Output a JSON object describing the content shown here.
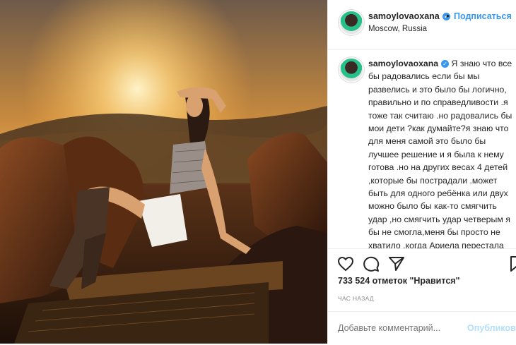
{
  "header": {
    "username": "samoylovaoxana",
    "verified": "✓",
    "separator": "•",
    "follow_label": "Подписаться",
    "location": "Moscow, Russia"
  },
  "caption": {
    "username": "samoylovaoxana",
    "verified": "✓",
    "text": "Я знаю что все бы радовались если бы мы развелись и это было бы логично, правильно и по справедливости .я тоже так считаю .но радовались бы мои дети ?как думайте?я знаю что для меня самой это было бы лучшее решение и я была к нему готова .но на других весах 4 детей ,которые бы пострадали .может быть для одного ребёнка или двух можно было бы как-то смягчить удар ,но смягчить удар четверым я бы не смогла,меня бы просто не хватило .когда Ариела перестала спать ночами в панических атаках и задыхаясь .я реально испугалась .не я к этому"
  },
  "actions": {
    "icons": [
      "heart-icon",
      "comment-icon",
      "share-icon",
      "bookmark-icon"
    ],
    "likes": "733 524 отметок \"Нравится\"",
    "time": "ЧАС НАЗАД"
  },
  "comment": {
    "placeholder": "Добавьте комментарий...",
    "publish_label": "Опубликовать"
  },
  "colors": {
    "accent": "#3897f0",
    "text": "#262626",
    "muted": "#8e8e8e",
    "border": "#efefef"
  }
}
